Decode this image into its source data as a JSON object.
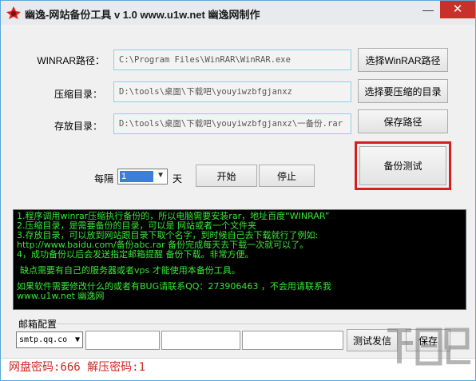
{
  "window": {
    "title": "幽逸-网站备份工具 v 1.0 www.u1w.net 幽逸网制作",
    "minimize_label": "—",
    "close_label": "✕",
    "icon": "app-logo-icon"
  },
  "fields": {
    "winrar_label": "WINRAR路径：",
    "winrar_value": "C:\\Program Files\\WinRAR\\WinRAR.exe",
    "source_label": "压缩目录：",
    "source_value": "D:\\tools\\桌面\\下载吧\\youyiwzbfgjanxz",
    "target_label": "存放目录：",
    "target_value": "D:\\tools\\桌面\\下载吧\\youyiwzbfgjanxz\\一备份.rar"
  },
  "buttons": {
    "select_winrar": "选择WinRAR路径",
    "select_source": "选择要压缩的目录",
    "save_path": "保存路径",
    "backup_test": "备份测试",
    "start": "开始",
    "stop": "停止",
    "test_mail": "测试发信",
    "save_mail": "保存"
  },
  "schedule": {
    "every_label": "每隔",
    "interval_value": "1",
    "unit_label": "天"
  },
  "log": {
    "lines": [
      "1.程序调用winrar压缩执行备份的，所以电脑需要安装rar，地址百度“WINRAR”",
      "2.压缩目录，是需要备份的目录，可以是 网站或者一个文件夹",
      "3.存放目录，可以放到网站跟目录下取个名字，到时候自己去下载就行了例如:",
      "http://www.baidu.com/备份abc.rar 备份完成每天去下载一次就可以了。",
      "4，成功备份以后会发送指定邮箱提醒 备份下载。非常方便。",
      "",
      "缺点需要有自己的服务器或者vps 才能使用本备份工具。",
      "",
      "如果软件需要修改什么的或者有BUG请联系QQ：273906463 ，不会用请联系我",
      "www.u1w.net 幽逸网"
    ]
  },
  "email": {
    "group_label": "邮箱配置",
    "smtp_value": "smtp.qq.co"
  },
  "status": {
    "text": "网盘密码:666 解压密码:1"
  },
  "watermark": {
    "text": "下载吧"
  },
  "colors": {
    "highlight": "#d21f1f",
    "log_text": "#38e838",
    "status_text": "#d32424"
  }
}
